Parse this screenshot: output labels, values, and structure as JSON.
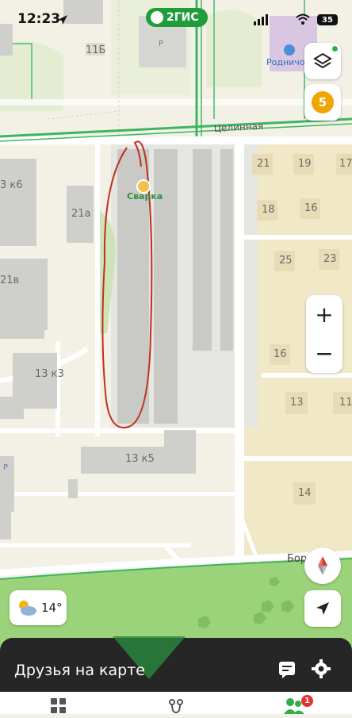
{
  "status": {
    "time": "12:23",
    "brand": "2ГИС",
    "battery": "35"
  },
  "map": {
    "street_top": "Целинная",
    "street_bottom": "Боров",
    "poi_name": "Сварка",
    "poi_kindergarten": "Родничок",
    "building_labels": [
      "11Б",
      "3 к6",
      "21а",
      "21в",
      "13 к3",
      "13 к5",
      "21",
      "19",
      "17",
      "18",
      "16",
      "25",
      "23",
      "16",
      "13",
      "11",
      "14"
    ]
  },
  "controls": {
    "notifications_count": "5",
    "zoom_in": "+",
    "zoom_out": "−",
    "temperature": "14°"
  },
  "panel": {
    "title": "Друзья на карте"
  },
  "tabs": {
    "friends_badge": "1"
  },
  "colors": {
    "brand_green": "#1f9d3a",
    "road_green": "#3db560",
    "annotation_red": "#c0301f",
    "badge_orange": "#f0a500",
    "park_green": "#9bd37a",
    "panel_dark": "#262626"
  }
}
